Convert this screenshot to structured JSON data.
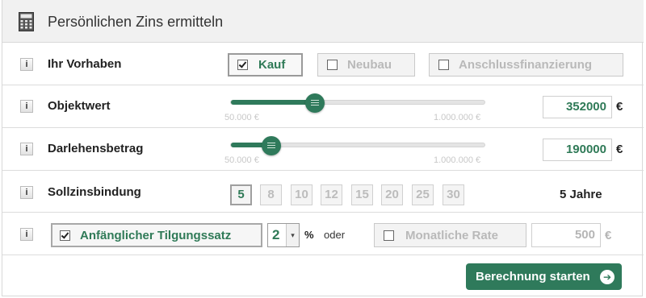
{
  "header": {
    "title": "Persönlichen Zins ermitteln",
    "icon": "calculator-icon"
  },
  "info_label": "i",
  "vorhaben": {
    "label": "Ihr Vorhaben",
    "options": [
      {
        "label": "Kauf",
        "checked": true
      },
      {
        "label": "Neubau",
        "checked": false
      },
      {
        "label": "Anschlussfinanzierung",
        "checked": false
      }
    ]
  },
  "objektwert": {
    "label": "Objektwert",
    "min_label": "50.000 €",
    "max_label": "1.000.000 €",
    "value": "352000",
    "unit": "€",
    "slider_fraction": 0.33
  },
  "darlehen": {
    "label": "Darlehensbetrag",
    "min_label": "50.000 €",
    "max_label": "1.000.000 €",
    "value": "190000",
    "unit": "€",
    "slider_fraction": 0.16
  },
  "sollzins": {
    "label": "Sollzinsbindung",
    "options": [
      "5",
      "8",
      "10",
      "12",
      "15",
      "20",
      "25",
      "30"
    ],
    "selected": "5",
    "selected_label": "5 Jahre"
  },
  "tilgung": {
    "label": "Anfänglicher Tilgungssatz",
    "checked": true,
    "select_value": "2",
    "select_arrow": "▾",
    "percent": "%",
    "oder": "oder",
    "rate_label": "Monatliche Rate",
    "rate_checked": false,
    "rate_value": "500",
    "rate_unit": "€"
  },
  "start_button": {
    "label": "Berechnung starten",
    "icon": "arrow-right-circle-icon",
    "glyph": "➔"
  },
  "colors": {
    "accent": "#2f7a5b",
    "disabled_text": "#b9b9b9",
    "header_bg": "#f1f1f1"
  }
}
